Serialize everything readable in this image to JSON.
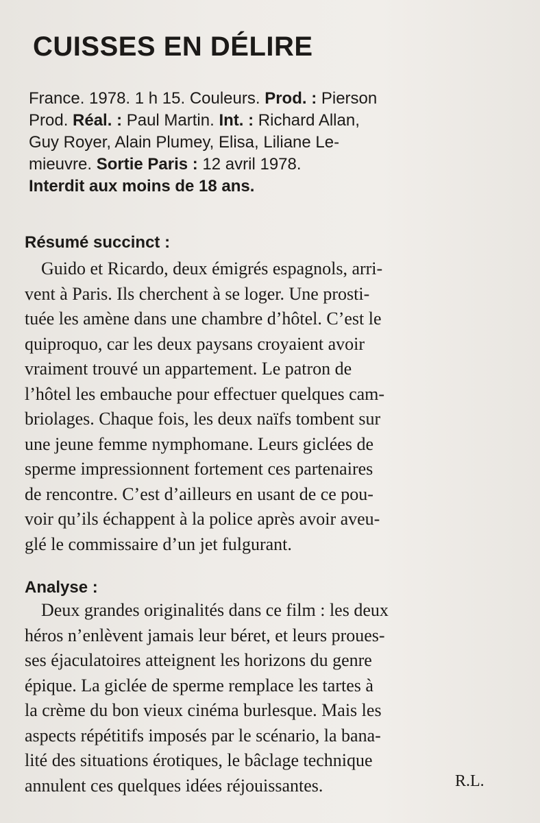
{
  "title": "CUISSES EN DÉLIRE",
  "credits": {
    "line1_a": "France. 1978. 1 h 15. Couleurs. ",
    "prod_label": "Prod. :",
    "line1_b": " Pierson",
    "line2_a": "Prod. ",
    "real_label": "Réal. :",
    "line2_b": " Paul Martin. ",
    "int_label": "Int. :",
    "line2_c": " Richard Allan,",
    "line3": "Guy Royer, Alain Plumey, Elisa, Liliane Le-",
    "line4_a": "mieuvre. ",
    "sortie_label": "Sortie Paris :",
    "line4_b": " 12 avril 1978.",
    "rating": "Interdit aux moins de 18 ans."
  },
  "summary": {
    "heading": "Résumé succinct :",
    "lines": [
      "Guido et Ricardo, deux émigrés espagnols, arri-",
      "vent à Paris. Ils cherchent à se loger. Une prosti-",
      "tuée les amène dans une chambre d’hôtel. C’est le",
      "quiproquo, car les deux paysans croyaient avoir",
      "vraiment trouvé un appartement. Le patron de",
      "l’hôtel les embauche pour effectuer quelques cam-",
      "briolages. Chaque fois, les deux naïfs tombent sur",
      "une jeune femme nymphomane. Leurs giclées de",
      "sperme impressionnent fortement ces partenaires",
      "de rencontre. C’est d’ailleurs en usant de ce pou-",
      "voir qu’ils échappent à la police après avoir aveu-",
      "glé le commissaire d’un jet fulgurant."
    ]
  },
  "analysis": {
    "heading": "Analyse :",
    "lines": [
      "Deux grandes originalités dans ce film : les deux",
      "héros n’enlèvent jamais leur béret, et leurs proues-",
      "ses éjaculatoires atteignent les horizons du genre",
      "épique. La giclée de sperme remplace les tartes à",
      "la crème du bon vieux cinéma burlesque. Mais les",
      "aspects répétitifs imposés par le scénario, la bana-",
      "lité des situations érotiques, le bâclage technique",
      "annulent ces quelques idées réjouissantes."
    ]
  },
  "signature": "R.L."
}
